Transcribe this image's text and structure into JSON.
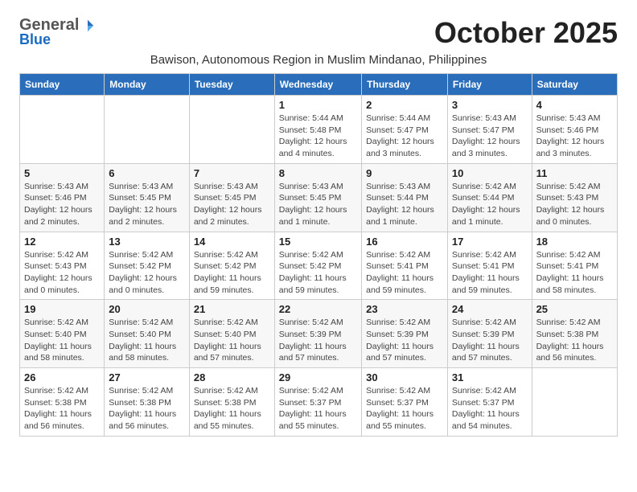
{
  "logo": {
    "general": "General",
    "blue": "Blue"
  },
  "month": "October 2025",
  "subtitle": "Bawison, Autonomous Region in Muslim Mindanao, Philippines",
  "days_of_week": [
    "Sunday",
    "Monday",
    "Tuesday",
    "Wednesday",
    "Thursday",
    "Friday",
    "Saturday"
  ],
  "weeks": [
    [
      {
        "day": "",
        "info": ""
      },
      {
        "day": "",
        "info": ""
      },
      {
        "day": "",
        "info": ""
      },
      {
        "day": "1",
        "info": "Sunrise: 5:44 AM\nSunset: 5:48 PM\nDaylight: 12 hours\nand 4 minutes."
      },
      {
        "day": "2",
        "info": "Sunrise: 5:44 AM\nSunset: 5:47 PM\nDaylight: 12 hours\nand 3 minutes."
      },
      {
        "day": "3",
        "info": "Sunrise: 5:43 AM\nSunset: 5:47 PM\nDaylight: 12 hours\nand 3 minutes."
      },
      {
        "day": "4",
        "info": "Sunrise: 5:43 AM\nSunset: 5:46 PM\nDaylight: 12 hours\nand 3 minutes."
      }
    ],
    [
      {
        "day": "5",
        "info": "Sunrise: 5:43 AM\nSunset: 5:46 PM\nDaylight: 12 hours\nand 2 minutes."
      },
      {
        "day": "6",
        "info": "Sunrise: 5:43 AM\nSunset: 5:45 PM\nDaylight: 12 hours\nand 2 minutes."
      },
      {
        "day": "7",
        "info": "Sunrise: 5:43 AM\nSunset: 5:45 PM\nDaylight: 12 hours\nand 2 minutes."
      },
      {
        "day": "8",
        "info": "Sunrise: 5:43 AM\nSunset: 5:45 PM\nDaylight: 12 hours\nand 1 minute."
      },
      {
        "day": "9",
        "info": "Sunrise: 5:43 AM\nSunset: 5:44 PM\nDaylight: 12 hours\nand 1 minute."
      },
      {
        "day": "10",
        "info": "Sunrise: 5:42 AM\nSunset: 5:44 PM\nDaylight: 12 hours\nand 1 minute."
      },
      {
        "day": "11",
        "info": "Sunrise: 5:42 AM\nSunset: 5:43 PM\nDaylight: 12 hours\nand 0 minutes."
      }
    ],
    [
      {
        "day": "12",
        "info": "Sunrise: 5:42 AM\nSunset: 5:43 PM\nDaylight: 12 hours\nand 0 minutes."
      },
      {
        "day": "13",
        "info": "Sunrise: 5:42 AM\nSunset: 5:42 PM\nDaylight: 12 hours\nand 0 minutes."
      },
      {
        "day": "14",
        "info": "Sunrise: 5:42 AM\nSunset: 5:42 PM\nDaylight: 11 hours\nand 59 minutes."
      },
      {
        "day": "15",
        "info": "Sunrise: 5:42 AM\nSunset: 5:42 PM\nDaylight: 11 hours\nand 59 minutes."
      },
      {
        "day": "16",
        "info": "Sunrise: 5:42 AM\nSunset: 5:41 PM\nDaylight: 11 hours\nand 59 minutes."
      },
      {
        "day": "17",
        "info": "Sunrise: 5:42 AM\nSunset: 5:41 PM\nDaylight: 11 hours\nand 59 minutes."
      },
      {
        "day": "18",
        "info": "Sunrise: 5:42 AM\nSunset: 5:41 PM\nDaylight: 11 hours\nand 58 minutes."
      }
    ],
    [
      {
        "day": "19",
        "info": "Sunrise: 5:42 AM\nSunset: 5:40 PM\nDaylight: 11 hours\nand 58 minutes."
      },
      {
        "day": "20",
        "info": "Sunrise: 5:42 AM\nSunset: 5:40 PM\nDaylight: 11 hours\nand 58 minutes."
      },
      {
        "day": "21",
        "info": "Sunrise: 5:42 AM\nSunset: 5:40 PM\nDaylight: 11 hours\nand 57 minutes."
      },
      {
        "day": "22",
        "info": "Sunrise: 5:42 AM\nSunset: 5:39 PM\nDaylight: 11 hours\nand 57 minutes."
      },
      {
        "day": "23",
        "info": "Sunrise: 5:42 AM\nSunset: 5:39 PM\nDaylight: 11 hours\nand 57 minutes."
      },
      {
        "day": "24",
        "info": "Sunrise: 5:42 AM\nSunset: 5:39 PM\nDaylight: 11 hours\nand 57 minutes."
      },
      {
        "day": "25",
        "info": "Sunrise: 5:42 AM\nSunset: 5:38 PM\nDaylight: 11 hours\nand 56 minutes."
      }
    ],
    [
      {
        "day": "26",
        "info": "Sunrise: 5:42 AM\nSunset: 5:38 PM\nDaylight: 11 hours\nand 56 minutes."
      },
      {
        "day": "27",
        "info": "Sunrise: 5:42 AM\nSunset: 5:38 PM\nDaylight: 11 hours\nand 56 minutes."
      },
      {
        "day": "28",
        "info": "Sunrise: 5:42 AM\nSunset: 5:38 PM\nDaylight: 11 hours\nand 55 minutes."
      },
      {
        "day": "29",
        "info": "Sunrise: 5:42 AM\nSunset: 5:37 PM\nDaylight: 11 hours\nand 55 minutes."
      },
      {
        "day": "30",
        "info": "Sunrise: 5:42 AM\nSunset: 5:37 PM\nDaylight: 11 hours\nand 55 minutes."
      },
      {
        "day": "31",
        "info": "Sunrise: 5:42 AM\nSunset: 5:37 PM\nDaylight: 11 hours\nand 54 minutes."
      },
      {
        "day": "",
        "info": ""
      }
    ]
  ]
}
